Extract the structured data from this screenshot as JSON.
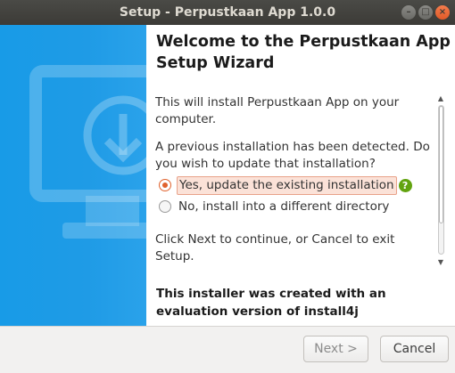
{
  "window": {
    "title": "Setup - Perpustkaan App 1.0.0",
    "controls": {
      "minimize": "–",
      "maximize": "□",
      "close": "×"
    }
  },
  "heading": "Welcome to the Perpustkaan App Setup Wizard",
  "body": {
    "intro": "This will install Perpustkaan App on your computer.",
    "previous_install": "A previous installation has been detected. Do you wish to update that installation?",
    "options": [
      {
        "label": "Yes, update the existing installation",
        "selected": true
      },
      {
        "label": "No, install into a different directory",
        "selected": false
      }
    ],
    "help_icon_glyph": "?",
    "continue_text": "Click Next to continue, or Cancel to exit Setup."
  },
  "footer_note": "This installer was created with an evaluation version of install4j",
  "buttons": {
    "next": "Next >",
    "cancel": "Cancel"
  },
  "colors": {
    "accent": "#e0622d",
    "sidebar": "#1f9be6",
    "help": "#62a30f"
  }
}
